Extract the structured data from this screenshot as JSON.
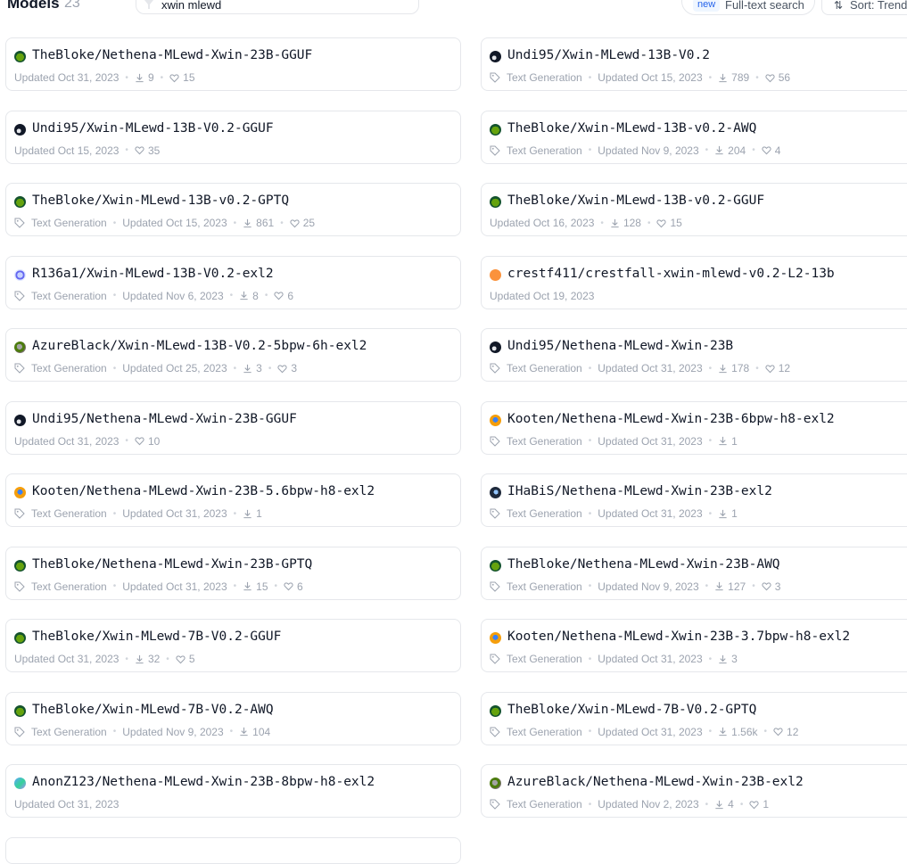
{
  "header": {
    "title": "Models",
    "count": "23",
    "search_value": "xwin mlewd",
    "fulltext_badge": "new",
    "fulltext_label": "Full-text search",
    "sort_label": "Sort:  Trending"
  },
  "cards": [
    {
      "name": "TheBloke/Nethena-MLewd-Xwin-23B-GGUF",
      "avatar": "av-bloke",
      "task": "",
      "updated": "Updated Oct 31, 2023",
      "downloads": "9",
      "likes": "15"
    },
    {
      "name": "Undi95/Xwin-MLewd-13B-V0.2",
      "avatar": "av-undi",
      "task": "Text Generation",
      "updated": "Updated Oct 15, 2023",
      "downloads": "789",
      "likes": "56"
    },
    {
      "name": "Undi95/Xwin-MLewd-13B-V0.2-GGUF",
      "avatar": "av-undi",
      "task": "",
      "updated": "Updated Oct 15, 2023",
      "downloads": "",
      "likes": "35"
    },
    {
      "name": "TheBloke/Xwin-MLewd-13B-v0.2-AWQ",
      "avatar": "av-bloke",
      "task": "Text Generation",
      "updated": "Updated Nov 9, 2023",
      "downloads": "204",
      "likes": "4"
    },
    {
      "name": "TheBloke/Xwin-MLewd-13B-v0.2-GPTQ",
      "avatar": "av-bloke",
      "task": "Text Generation",
      "updated": "Updated Oct 15, 2023",
      "downloads": "861",
      "likes": "25"
    },
    {
      "name": "TheBloke/Xwin-MLewd-13B-v0.2-GGUF",
      "avatar": "av-bloke",
      "task": "",
      "updated": "Updated Oct 16, 2023",
      "downloads": "128",
      "likes": "15"
    },
    {
      "name": "R136a1/Xwin-MLewd-13B-V0.2-exl2",
      "avatar": "av-r136",
      "task": "Text Generation",
      "updated": "Updated Nov 6, 2023",
      "downloads": "8",
      "likes": "6"
    },
    {
      "name": "crestf411/crestfall-xwin-mlewd-v0.2-L2-13b",
      "avatar": "av-crest",
      "task": "",
      "updated": "Updated Oct 19, 2023",
      "downloads": "",
      "likes": ""
    },
    {
      "name": "AzureBlack/Xwin-MLewd-13B-V0.2-5bpw-6h-exl2",
      "avatar": "av-azure",
      "task": "Text Generation",
      "updated": "Updated Oct 25, 2023",
      "downloads": "3",
      "likes": "3"
    },
    {
      "name": "Undi95/Nethena-MLewd-Xwin-23B",
      "avatar": "av-undi",
      "task": "Text Generation",
      "updated": "Updated Oct 31, 2023",
      "downloads": "178",
      "likes": "12"
    },
    {
      "name": "Undi95/Nethena-MLewd-Xwin-23B-GGUF",
      "avatar": "av-undi",
      "task": "",
      "updated": "Updated Oct 31, 2023",
      "downloads": "",
      "likes": "10"
    },
    {
      "name": "Kooten/Nethena-MLewd-Xwin-23B-6bpw-h8-exl2",
      "avatar": "av-kooten",
      "task": "Text Generation",
      "updated": "Updated Oct 31, 2023",
      "downloads": "1",
      "likes": ""
    },
    {
      "name": "Kooten/Nethena-MLewd-Xwin-23B-5.6bpw-h8-exl2",
      "avatar": "av-kooten",
      "task": "Text Generation",
      "updated": "Updated Oct 31, 2023",
      "downloads": "1",
      "likes": ""
    },
    {
      "name": "IHaBiS/Nethena-MLewd-Xwin-23B-exl2",
      "avatar": "av-ihabis",
      "task": "Text Generation",
      "updated": "Updated Oct 31, 2023",
      "downloads": "1",
      "likes": ""
    },
    {
      "name": "TheBloke/Nethena-MLewd-Xwin-23B-GPTQ",
      "avatar": "av-bloke",
      "task": "Text Generation",
      "updated": "Updated Oct 31, 2023",
      "downloads": "15",
      "likes": "6"
    },
    {
      "name": "TheBloke/Nethena-MLewd-Xwin-23B-AWQ",
      "avatar": "av-bloke",
      "task": "Text Generation",
      "updated": "Updated Nov 9, 2023",
      "downloads": "127",
      "likes": "3"
    },
    {
      "name": "TheBloke/Xwin-MLewd-7B-V0.2-GGUF",
      "avatar": "av-bloke",
      "task": "",
      "updated": "Updated Oct 31, 2023",
      "downloads": "32",
      "likes": "5"
    },
    {
      "name": "Kooten/Nethena-MLewd-Xwin-23B-3.7bpw-h8-exl2",
      "avatar": "av-kooten",
      "task": "Text Generation",
      "updated": "Updated Oct 31, 2023",
      "downloads": "3",
      "likes": ""
    },
    {
      "name": "TheBloke/Xwin-MLewd-7B-V0.2-AWQ",
      "avatar": "av-bloke",
      "task": "Text Generation",
      "updated": "Updated Nov 9, 2023",
      "downloads": "104",
      "likes": ""
    },
    {
      "name": "TheBloke/Xwin-MLewd-7B-V0.2-GPTQ",
      "avatar": "av-bloke",
      "task": "Text Generation",
      "updated": "Updated Oct 31, 2023",
      "downloads": "1.56k",
      "likes": "12"
    },
    {
      "name": "AnonZ123/Nethena-MLewd-Xwin-23B-8bpw-h8-exl2",
      "avatar": "av-anon",
      "task": "",
      "updated": "Updated Oct 31, 2023",
      "downloads": "",
      "likes": ""
    },
    {
      "name": "AzureBlack/Nethena-MLewd-Xwin-23B-exl2",
      "avatar": "av-azure",
      "task": "Text Generation",
      "updated": "Updated Nov 2, 2023",
      "downloads": "4",
      "likes": "1"
    }
  ]
}
